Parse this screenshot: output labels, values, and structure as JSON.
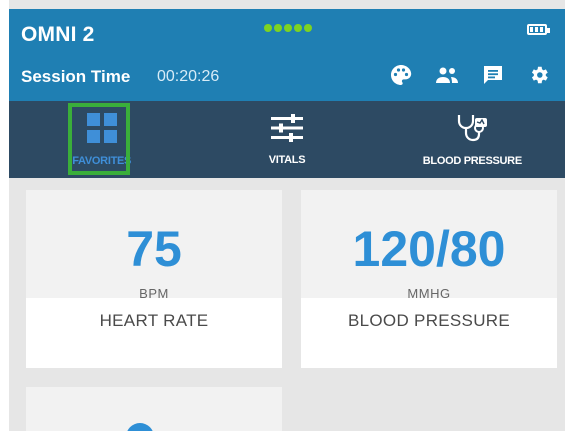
{
  "header": {
    "app_title": "OMNI 2",
    "session_label": "Session Time",
    "session_time": "00:20:26",
    "signal_color": "#7ed321",
    "icons": [
      "palette-icon",
      "users-icon",
      "notes-icon",
      "settings-gear-icon"
    ]
  },
  "tabs": [
    {
      "label": "FAVORITES",
      "icon": "grid-icon",
      "active": true
    },
    {
      "label": "VITALS",
      "icon": "sliders-icon",
      "active": false
    },
    {
      "label": "BLOOD PRESSURE",
      "icon": "stethoscope-icon",
      "active": false
    }
  ],
  "cards": [
    {
      "value": "75",
      "unit": "BPM",
      "label": "HEART RATE"
    },
    {
      "value": "120/80",
      "unit": "MMHG",
      "label": "BLOOD PRESSURE"
    }
  ],
  "colors": {
    "header_bg": "#1f7fb3",
    "tabbar_bg": "#2d4a63",
    "accent": "#2e8fd6",
    "highlight": "#3aae3a"
  }
}
